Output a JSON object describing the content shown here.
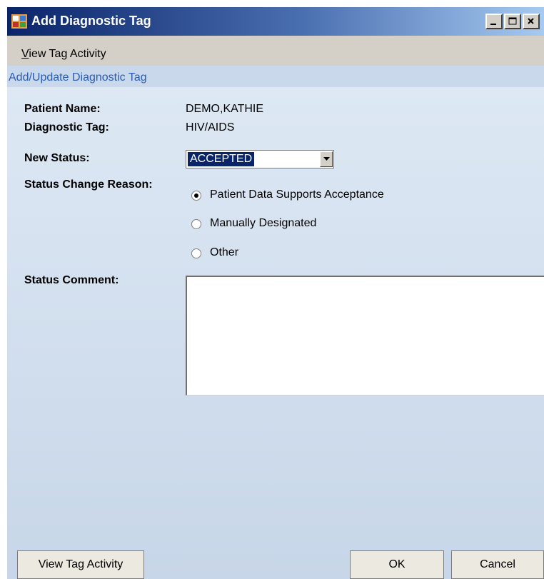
{
  "window": {
    "title": "Add Diagnostic Tag"
  },
  "menu": {
    "view_tag_activity_prefix": "V",
    "view_tag_activity_rest": "iew Tag Activity"
  },
  "section": {
    "title": "Add/Update Diagnostic Tag"
  },
  "form": {
    "patient_name_label": "Patient Name:",
    "patient_name_value": "DEMO,KATHIE",
    "diagnostic_tag_label": "Diagnostic Tag:",
    "diagnostic_tag_value": "HIV/AIDS",
    "new_status_label": "New Status:",
    "new_status_value": "ACCEPTED",
    "status_change_reason_label": "Status Change Reason:",
    "reasons": [
      {
        "label": "Patient Data Supports Acceptance",
        "selected": true
      },
      {
        "label": "Manually Designated",
        "selected": false
      },
      {
        "label": "Other",
        "selected": false
      }
    ],
    "status_comment_label": "Status Comment:",
    "status_comment_value": ""
  },
  "buttons": {
    "view_tag_activity": "View Tag Activity",
    "ok": "OK",
    "cancel": "Cancel"
  },
  "colors": {
    "title_bar_start": "#0a246a",
    "section_text": "#2a5db0",
    "content_background": "#dde8f4",
    "selection_highlight": "#0a246a"
  }
}
